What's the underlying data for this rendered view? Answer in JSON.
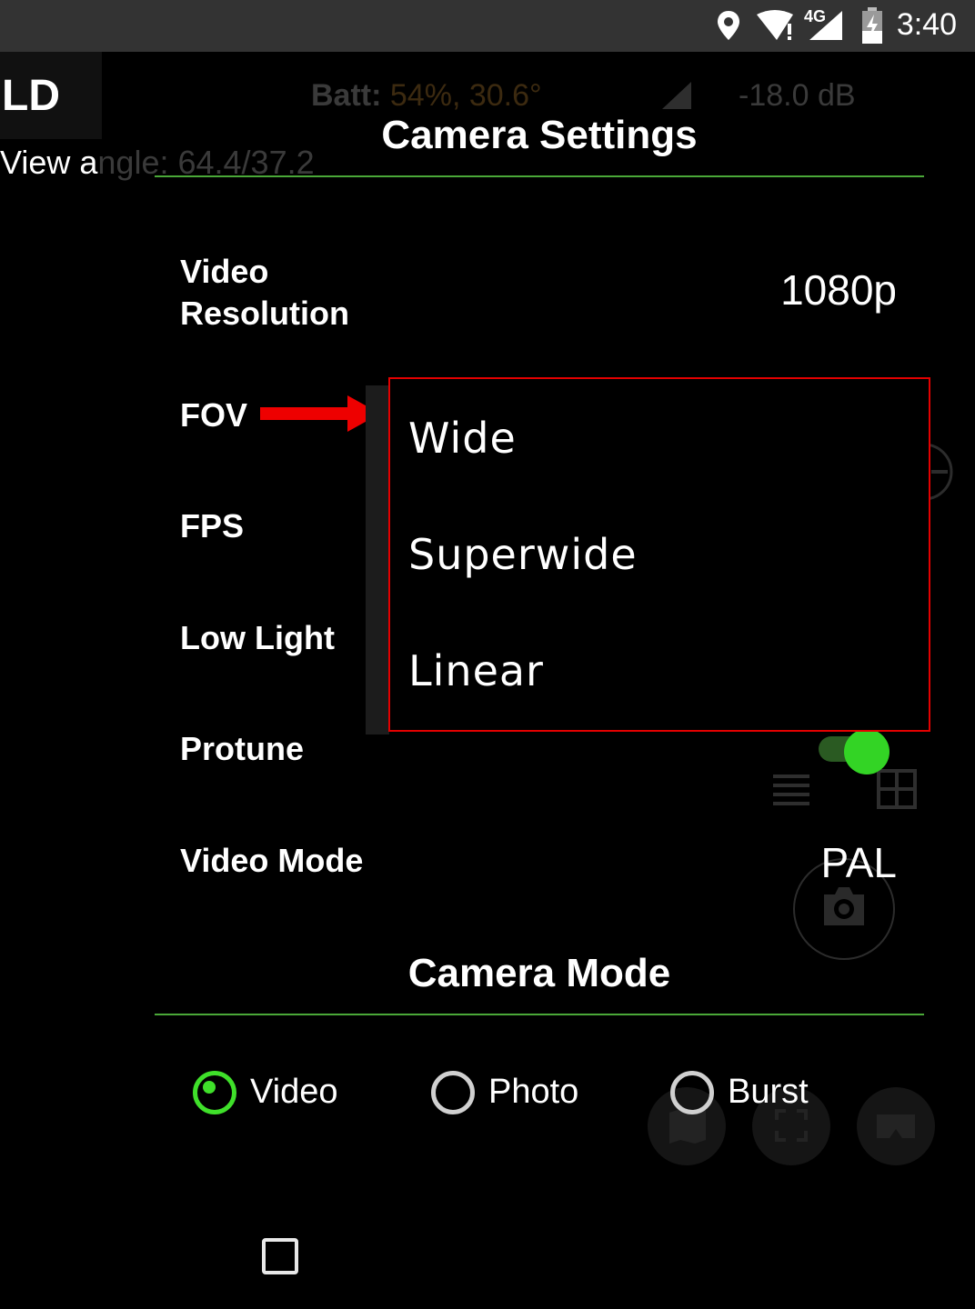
{
  "status_bar": {
    "network": "4G",
    "time": "3:40",
    "icons": [
      "location-icon",
      "wifi-icon",
      "signal-icon",
      "battery-charging-icon"
    ]
  },
  "background": {
    "ld_text": "LD",
    "view_prefix": "View a",
    "view_suffix": "ngle: 64.4/37.2",
    "batt_label": "Batt:",
    "batt_value": "54%, 30.6°",
    "db_value": "-18.0 dB"
  },
  "dialog": {
    "title": "Camera Settings",
    "settings": [
      {
        "label_line1": "Video",
        "label_line2": "Resolution",
        "value": "1080p"
      },
      {
        "label": "FOV"
      },
      {
        "label": "FPS"
      },
      {
        "label": "Low Light"
      },
      {
        "label": "Protune",
        "toggle_on": true
      },
      {
        "label": "Video Mode",
        "value": "PAL"
      }
    ],
    "fov_dropdown": {
      "options": [
        "Wide",
        "Superwide",
        "Linear"
      ]
    },
    "camera_mode_title": "Camera Mode",
    "camera_modes": [
      {
        "label": "Video",
        "selected": true
      },
      {
        "label": "Photo",
        "selected": false
      },
      {
        "label": "Burst",
        "selected": false
      }
    ]
  },
  "colors": {
    "accent_green": "#3fe02a",
    "divider_green": "#4aa838",
    "highlight_red": "#e30000",
    "status_bar_bg": "#333333"
  }
}
